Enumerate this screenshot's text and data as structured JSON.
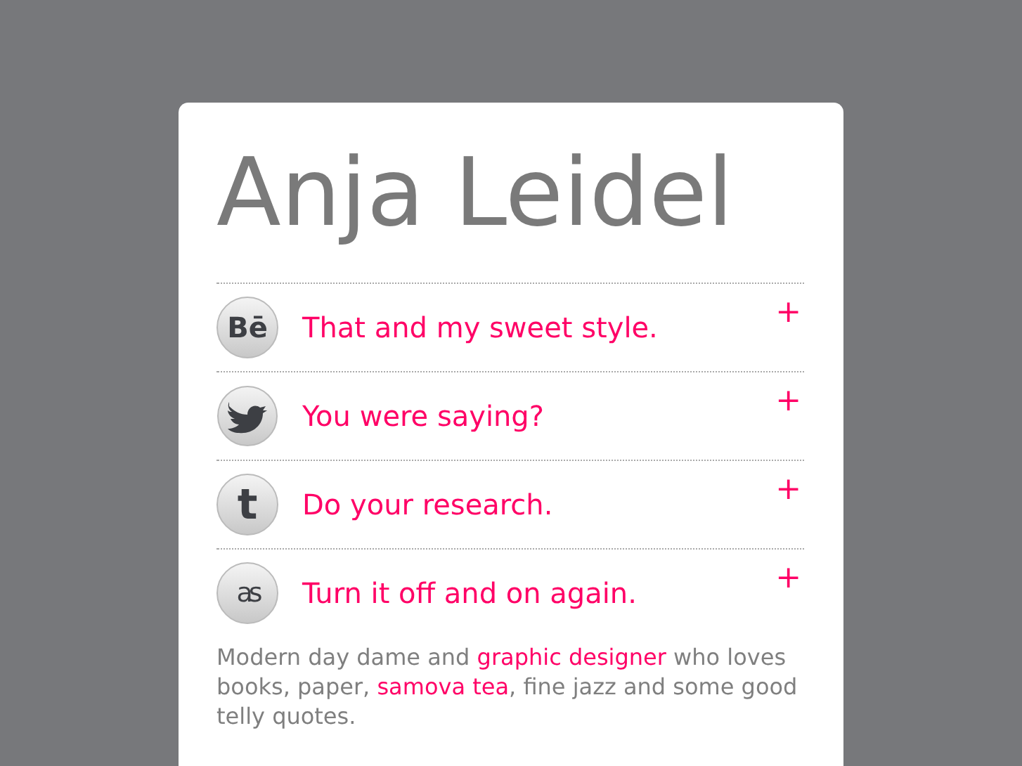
{
  "title": "Anja Leidel",
  "links": [
    {
      "kind": "behance",
      "glyph": "Bē",
      "label": "That and my sweet style.",
      "toggle": "+"
    },
    {
      "kind": "twitter",
      "label": "You were saying?",
      "toggle": "+"
    },
    {
      "kind": "tumblr",
      "glyph": "t",
      "label": "Do your research.",
      "toggle": "+"
    },
    {
      "kind": "lastfm",
      "glyph": "as",
      "label": "Turn it off and on again.",
      "toggle": "+"
    }
  ],
  "bio": [
    {
      "text": "Modern day dame and ",
      "link": false
    },
    {
      "text": "graphic designer",
      "link": true
    },
    {
      "text": " who loves books, paper, ",
      "link": false
    },
    {
      "text": "samova tea",
      "link": true
    },
    {
      "text": ", fine jazz and some good telly quotes.",
      "link": false
    }
  ]
}
